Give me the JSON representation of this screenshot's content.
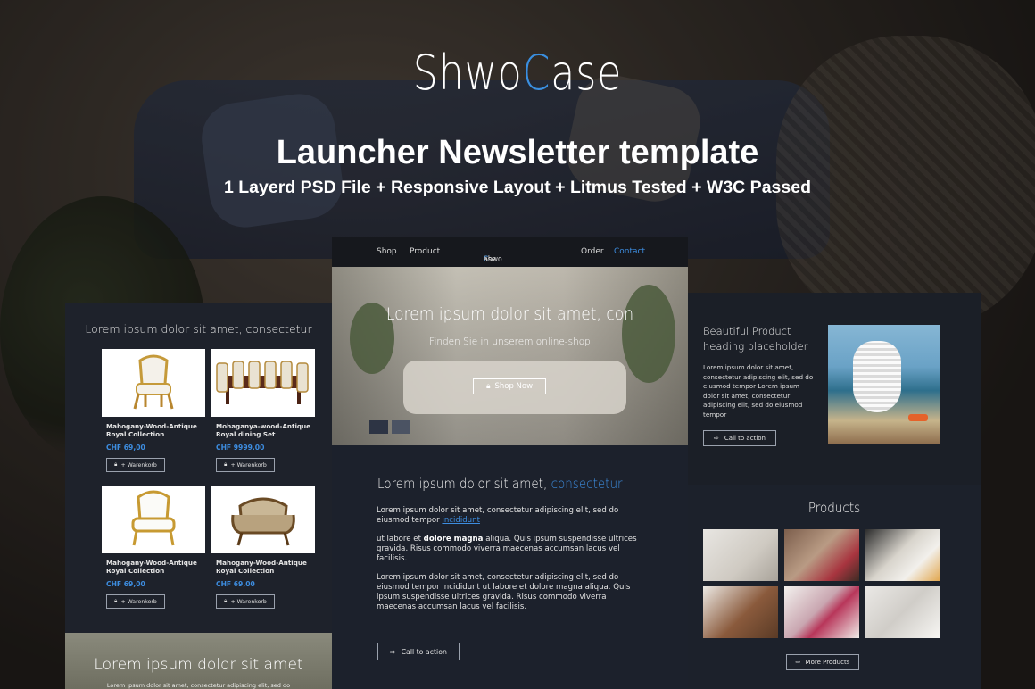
{
  "brand": {
    "logo_pre": "Shwo",
    "logo_accent": "C",
    "logo_post": "ase"
  },
  "header": {
    "title": "Launcher Newsletter template",
    "subtitle": "1 Layerd PSD File + Responsive Layout + Litmus Tested + W3C Passed"
  },
  "colors": {
    "accent": "#3d8de0",
    "panel": "#1e222b",
    "nav": "#16181d"
  },
  "left_panel": {
    "title": "Lorem ipsum dolor sit amet, consectetur",
    "products": [
      {
        "name": "Mahogany-Wood-Antique Royal Collection",
        "price": "CHF 69,00",
        "button": "+ Warenkorb"
      },
      {
        "name": "Mohaganya-wood-Antique Royal dining Set",
        "price": "CHF 9999.00",
        "button": "+ Warenkorb"
      },
      {
        "name": "Mahogany-Wood-Antique Royal Collection",
        "price": "CHF 69,00",
        "button": "+ Warenkorb"
      },
      {
        "name": "Mahogany-Wood-Antique Royal Collection",
        "price": "CHF 69,00",
        "button": "+ Warenkorb"
      }
    ],
    "bottom_title": "Lorem ipsum dolor sit amet",
    "bottom_sub": "Lorem ipsum dolor sit amet, consectetur adipiscing elit, sed do"
  },
  "center_panel": {
    "nav": {
      "shop": "Shop",
      "product": "Product",
      "order": "Order",
      "contact": "Contact"
    },
    "hero_title": "Lorem ipsum dolor sit amet, con",
    "hero_sub": "Finden Sie in unserem online-shop",
    "hero_button": "Shop Now",
    "heading_pre": "Lorem ipsum dolor sit amet,",
    "heading_accent": "consectetur",
    "p1_pre": "Lorem ipsum dolor sit amet, consectetur adipiscing elit, sed do eiusmod tempor",
    "p1_link": "incididunt",
    "p2_pre": "ut labore et",
    "p2_bold": "dolore magna",
    "p2_post": "aliqua. Quis ipsum suspendisse ultrices gravida. Risus commodo viverra maecenas accumsan lacus vel facilisis.",
    "p3": "Lorem ipsum dolor sit amet, consectetur adipiscing elit, sed do eiusmod tempor incididunt ut labore et dolore magna aliqua. Quis ipsum suspendisse ultrices gravida. Risus commodo viverra maecenas accumsan lacus vel facilisis.",
    "cta": "Call to action"
  },
  "right_panel": {
    "heading": "Beautiful Product heading placeholder",
    "text": "Lorem ipsum dolor sit amet, consectetur adipiscing elit, sed do eiusmod tempor Lorem ipsum dolor sit amet, consectetur adipiscing elit, sed do eiusmod tempor",
    "cta": "Call to action",
    "products_title": "Products",
    "more_button": "More Products"
  }
}
